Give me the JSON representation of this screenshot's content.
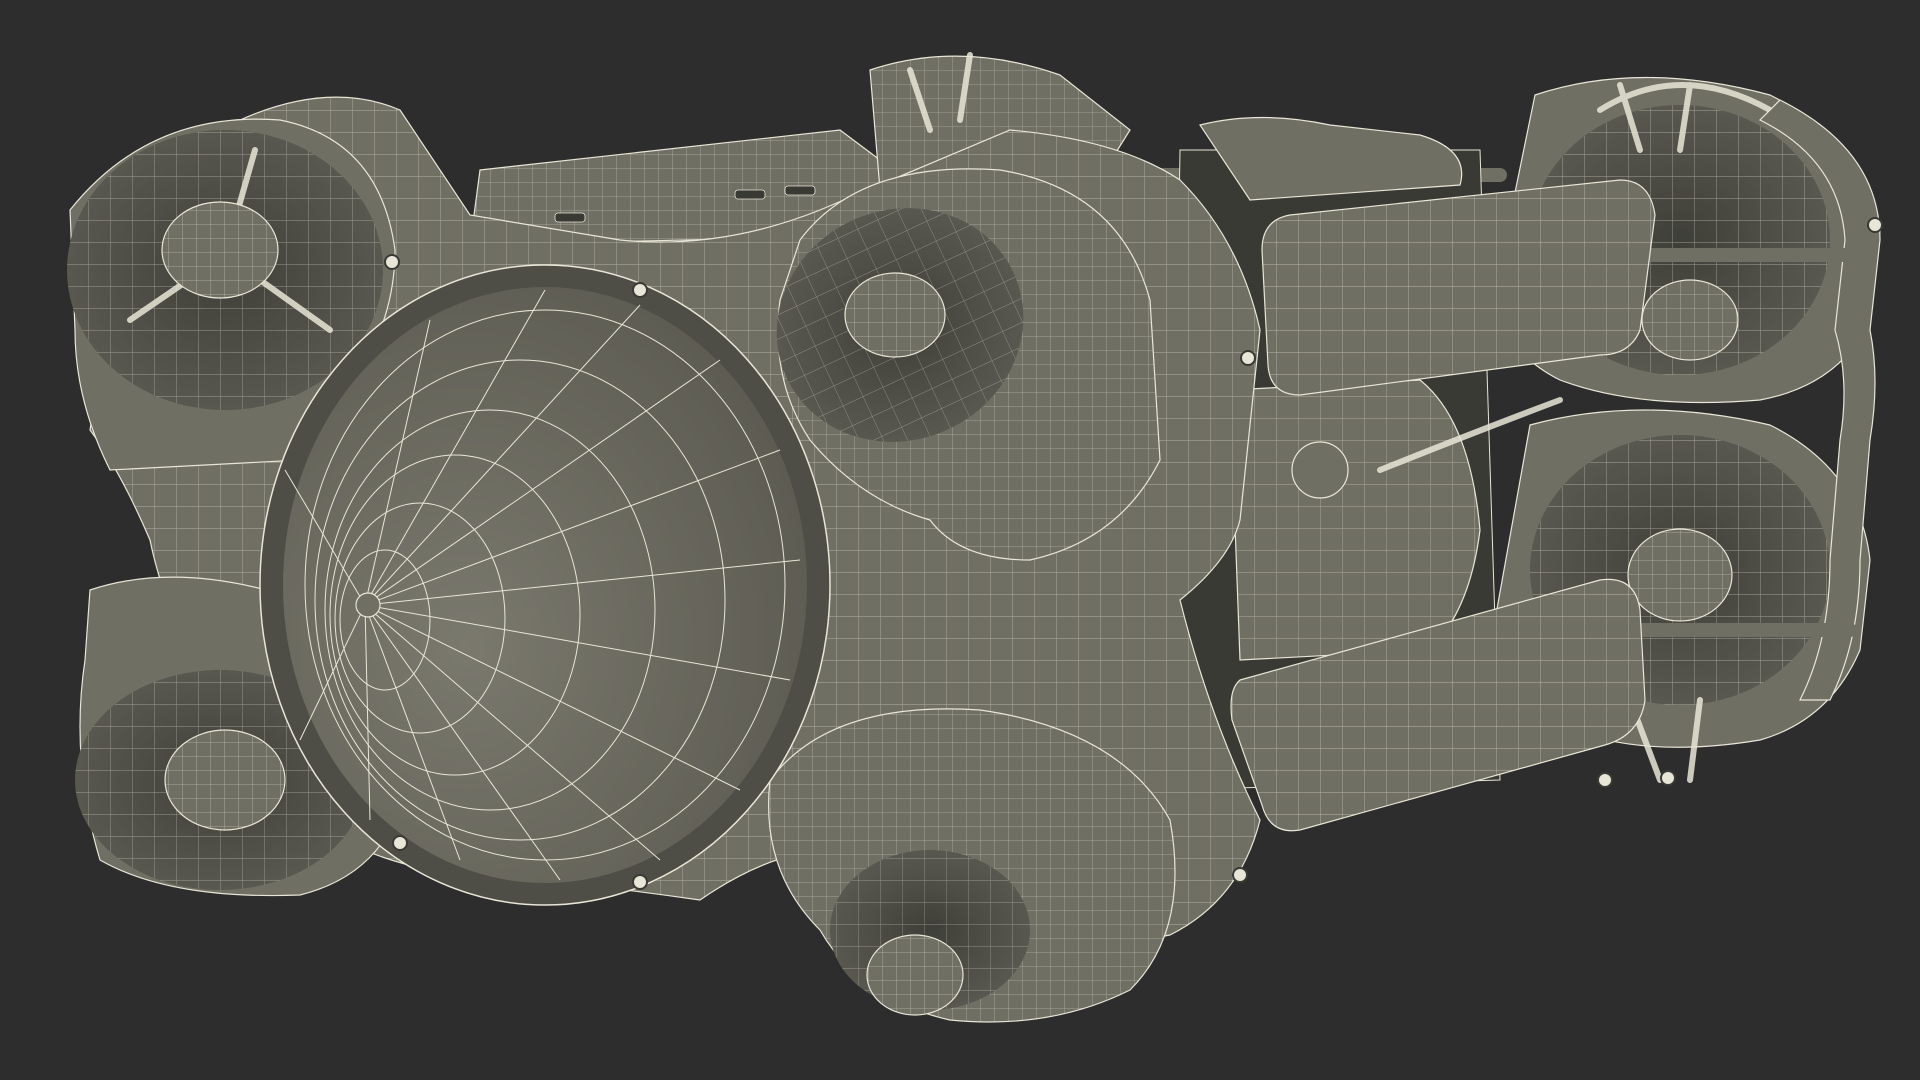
{
  "scene": {
    "subject_icon": "underwater-drone-icon",
    "render_style": "wireframe",
    "background_color": "#2d2d2d",
    "surface_color": "#706f64",
    "surface_shadow_color": "#4f4e46",
    "surface_dark_color": "#3a3a35",
    "wire_color": "#e8e6d6"
  }
}
